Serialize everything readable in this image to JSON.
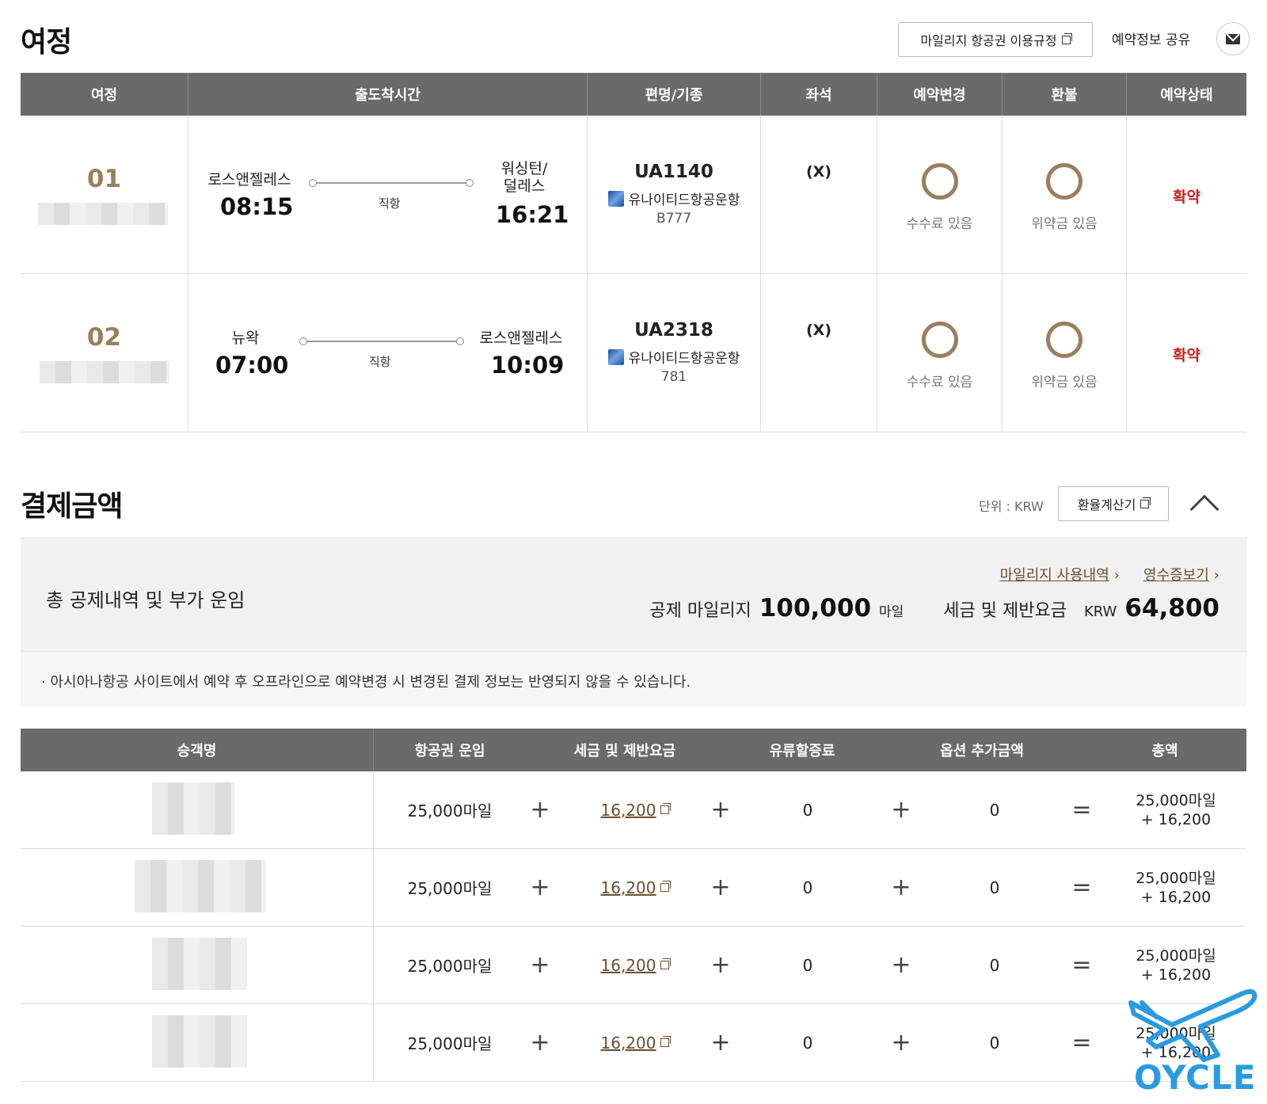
{
  "itinerary": {
    "title": "여정",
    "rules_button": "마일리지 항공권 이용규정",
    "share_label": "예약정보 공유",
    "headers": [
      "여정",
      "출도착시간",
      "편명/기종",
      "좌석",
      "예약변경",
      "환불",
      "예약상태"
    ],
    "segments": [
      {
        "no": "01",
        "origin": "로스앤젤레스",
        "dep_time": "08:15",
        "route_type": "직항",
        "destination": "워싱턴/\n덜레스",
        "arr_time": "16:21",
        "flight_no": "UA1140",
        "airline": "유나이티드항공운항",
        "aircraft": "B777",
        "seat": "(X)",
        "change_label": "수수료 있음",
        "refund_label": "위약금 있음",
        "status": "확약"
      },
      {
        "no": "02",
        "origin": "뉴왁",
        "dep_time": "07:00",
        "route_type": "직항",
        "destination": "로스앤젤레스",
        "arr_time": "10:09",
        "flight_no": "UA2318",
        "airline": "유나이티드항공운항",
        "aircraft": "781",
        "seat": "(X)",
        "change_label": "수수료 있음",
        "refund_label": "위약금 있음",
        "status": "확약"
      }
    ]
  },
  "payment": {
    "title": "결제금액",
    "unit_label": "단위 : KRW",
    "calc_button": "환율계산기",
    "summary_label": "총 공제내역 및 부가 운임",
    "link_mileage": "마일리지 사용내역",
    "link_receipt": "영수증보기",
    "deducted_label": "공제 마일리지",
    "deducted_value": "100,000",
    "deducted_unit": "마일",
    "tax_label": "세금 및 제반요금",
    "tax_currency": "KRW",
    "tax_value": "64,800",
    "notice": "· 아시아나항공 사이트에서 예약 후 오프라인으로 예약변경 시 변경된 결제 정보는 반영되지 않을 수 있습니다.",
    "headers": [
      "승객명",
      "항공권 운임",
      "세금 및 제반요금",
      "유류할증료",
      "옵션 추가금액",
      "총액"
    ],
    "operators": {
      "plus": "+",
      "equals": "="
    },
    "rows": [
      {
        "fare": "25,000마일",
        "tax": "16,200",
        "fuel": "0",
        "option": "0",
        "total_line1": "25,000마일",
        "total_line2": "+ 16,200"
      },
      {
        "fare": "25,000마일",
        "tax": "16,200",
        "fuel": "0",
        "option": "0",
        "total_line1": "25,000마일",
        "total_line2": "+ 16,200"
      },
      {
        "fare": "25,000마일",
        "tax": "16,200",
        "fuel": "0",
        "option": "0",
        "total_line1": "25,000마일",
        "total_line2": "+ 16,200"
      },
      {
        "fare": "25,000마일",
        "tax": "16,200",
        "fuel": "0",
        "option": "0",
        "total_line1": "25,000마일",
        "total_line2": "+ 16,200"
      }
    ]
  },
  "watermark": {
    "text": "OYCLE",
    "color": "#2a9be0"
  },
  "colors": {
    "header_bg": "#6a6a6a",
    "accent_brown": "#9a7f5f",
    "status_red": "#c81e1e",
    "link_brown": "#6b4f30"
  }
}
